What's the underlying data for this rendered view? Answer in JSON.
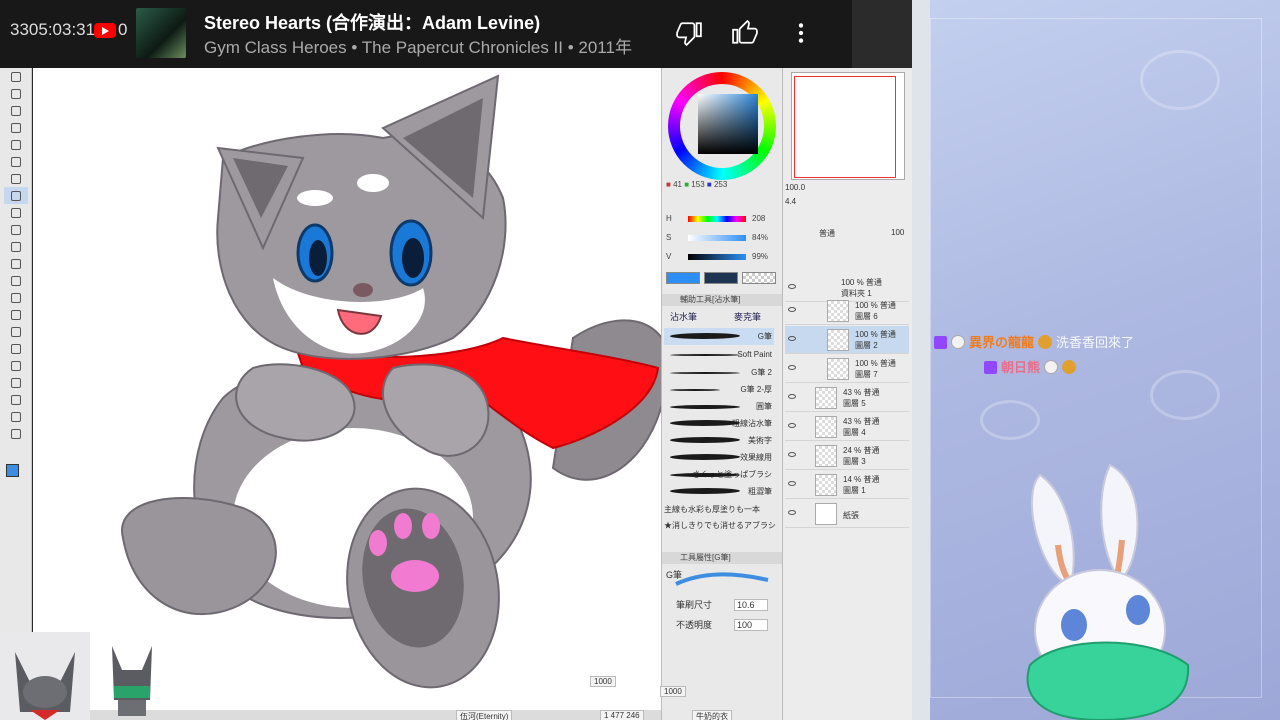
{
  "player": {
    "counter": "3305:03:31",
    "counter_right": "0",
    "title": "Stereo Hearts (合作演出：Adam Levine)",
    "subtitle": "Gym Class Heroes • The Papercut Chronicles II • 2011年",
    "icons": [
      "thumbs-down-icon",
      "thumbs-up-icon",
      "more-vert-icon"
    ]
  },
  "color_panel": {
    "rgb": [
      "41",
      "153",
      "253"
    ],
    "hsv": [
      {
        "label": "H",
        "value": "208"
      },
      {
        "label": "S",
        "value": "84%"
      },
      {
        "label": "V",
        "value": "99%"
      }
    ],
    "accent": "#2d8ff5"
  },
  "brush_panel": {
    "header": "輔助工具[沾水筆]",
    "tabs": [
      "沾水筆",
      "麥克筆"
    ],
    "items": [
      "G筆",
      "Soft Paint",
      "G筆 2",
      "G筆 2-厚",
      "圓筆",
      "粗線沾水筆",
      "美術字",
      "效果線用",
      "さくっと塗っぱブラシ",
      "粗澀筆"
    ],
    "footer": [
      "主線も水彩も厚塗りも一本",
      "★消しきりでも消せるアブラシ"
    ],
    "props_header": "工具屬性[G筆]",
    "brush_name": "G筆",
    "size_label": "筆刷尺寸",
    "size_value": "10.6",
    "opacity_label": "不透明度",
    "opacity_value": "100"
  },
  "layer_panel": {
    "zoom": "100.0",
    "angle": "4.4",
    "blend": "普通",
    "opacity": "100",
    "folder": {
      "l1": "100 % 普通",
      "l2": "資料夾 1"
    },
    "layers": [
      {
        "l1": "100 % 普通",
        "l2": "圖層 6",
        "selected": false
      },
      {
        "l1": "100 % 普通",
        "l2": "圖層 2",
        "selected": true
      },
      {
        "l1": "100 % 普通",
        "l2": "圖層 7",
        "selected": false
      },
      {
        "l1": "43 % 普通",
        "l2": "圖層 5",
        "selected": false
      },
      {
        "l1": "43 % 普通",
        "l2": "圖層 4",
        "selected": false
      },
      {
        "l1": "24 % 普通",
        "l2": "圖層 3",
        "selected": false
      },
      {
        "l1": "14 % 普通",
        "l2": "圖層 1",
        "selected": false
      },
      {
        "l1": "",
        "l2": "紙張",
        "selected": false
      }
    ]
  },
  "chat": [
    {
      "name": "異界の龍龍",
      "message": "洗香香回來了",
      "name_color": "#f07d1d"
    },
    {
      "name": "朝日熊",
      "message": "",
      "name_color": "#e86f8a"
    }
  ],
  "overlays": {
    "counter_a": "1000",
    "counter_b": "1000",
    "label_a": "伍河(Eternity)",
    "label_b": "1 477 246",
    "label_c": "牛奶的衣"
  }
}
